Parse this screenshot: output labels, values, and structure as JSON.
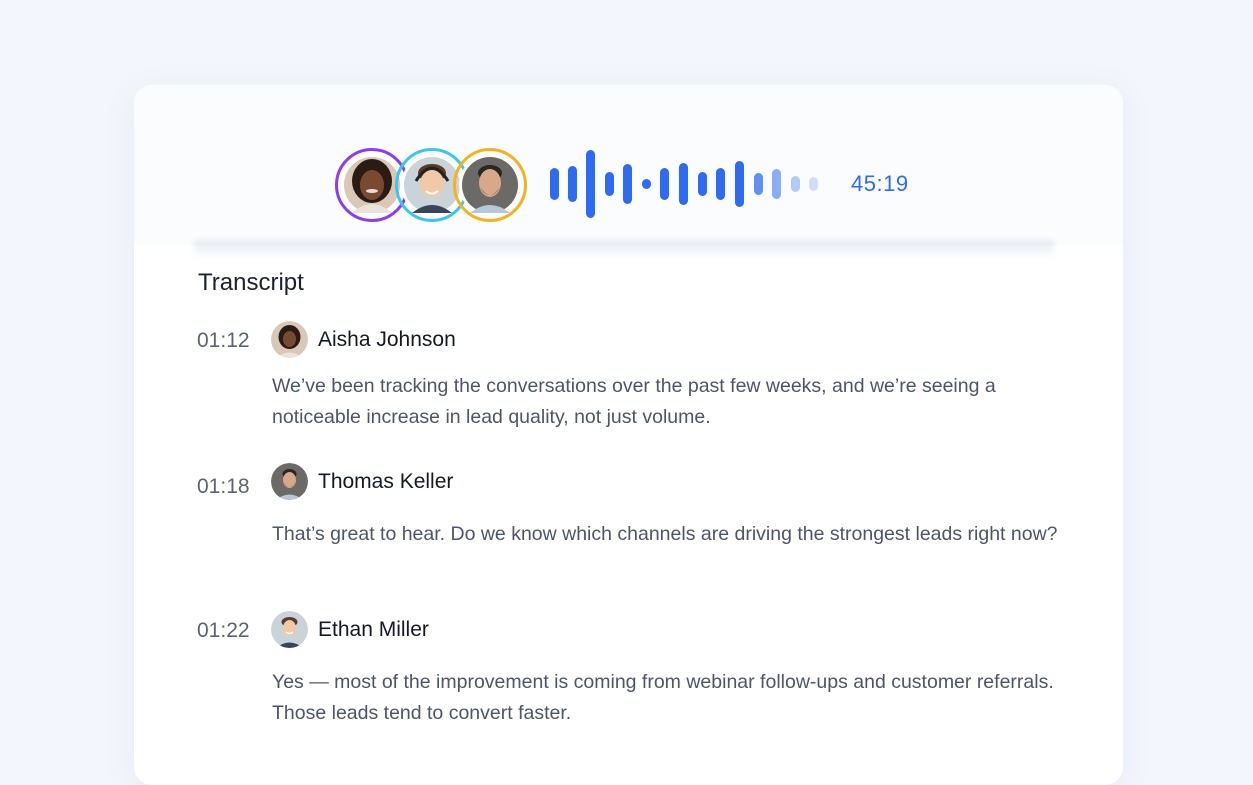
{
  "player": {
    "duration": "45:19",
    "participants": [
      {
        "name": "Aisha Johnson",
        "ring_color": "#8b3df0",
        "avatar_icon": "woman-avatar"
      },
      {
        "name": "Ethan Miller",
        "ring_color": "#3cc6e8",
        "avatar_icon": "young-man-headset-avatar"
      },
      {
        "name": "Thomas Keller",
        "ring_color": "#f3b320",
        "avatar_icon": "bearded-man-avatar"
      }
    ],
    "accent_color": "#2f6bf0"
  },
  "transcript": {
    "title": "Transcript",
    "entries": [
      {
        "time": "01:12",
        "speaker": "Aisha Johnson",
        "text": "We’ve been tracking the conversations over the past few weeks, and we’re seeing a noticeable increase in lead quality, not just volume."
      },
      {
        "time": "01:18",
        "speaker": "Thomas Keller",
        "text": "That’s great to hear. Do we know which channels are driving the strongest leads right now?"
      },
      {
        "time": "01:22",
        "speaker": "Ethan Miller",
        "text": "Yes — most of the improvement is coming from webinar follow-ups and customer referrals. Those leads tend to convert faster."
      }
    ]
  }
}
